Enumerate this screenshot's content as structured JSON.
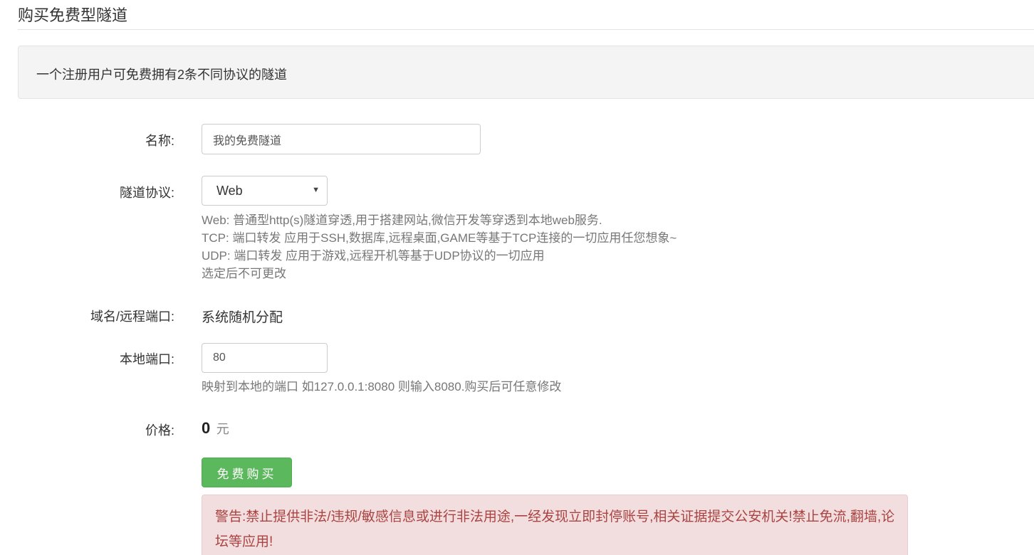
{
  "page": {
    "title": "购买免费型隧道"
  },
  "notice": {
    "text": "一个注册用户可免费拥有2条不同协议的隧道"
  },
  "form": {
    "name": {
      "label": "名称:",
      "value": "我的免费隧道"
    },
    "protocol": {
      "label": "隧道协议:",
      "selected": "Web",
      "help_lines": [
        "Web: 普通型http(s)隧道穿透,用于搭建网站,微信开发等穿透到本地web服务.",
        "TCP: 端口转发 应用于SSH,数据库,远程桌面,GAME等基于TCP连接的一切应用任您想象~",
        "UDP: 端口转发 应用于游戏,远程开机等基于UDP协议的一切应用",
        "选定后不可更改"
      ]
    },
    "domain": {
      "label": "域名/远程端口:",
      "value": "系统随机分配"
    },
    "local_port": {
      "label": "本地端口:",
      "value": "80",
      "help": "映射到本地的端口 如127.0.0.1:8080 则输入8080.购买后可任意修改"
    },
    "price": {
      "label": "价格:",
      "amount": "0",
      "unit": "元"
    },
    "submit_label": "免费购买"
  },
  "warning": {
    "text": "警告:禁止提供非法/违规/敏感信息或进行非法用途,一经发现立即封停账号,相关证据提交公安机关!禁止免流,翻墙,论坛等应用!"
  },
  "colors": {
    "button_bg": "#5cb85c",
    "warning_bg": "#f2dede",
    "warning_text": "#a94442",
    "help_text": "#777777"
  },
  "icons": {
    "select_caret": "caret-down-icon"
  }
}
